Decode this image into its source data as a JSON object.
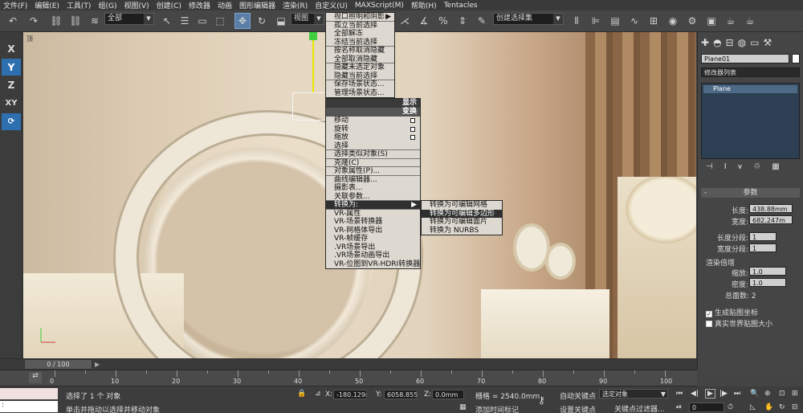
{
  "menubar": [
    "文件(F)",
    "编辑(E)",
    "工具(T)",
    "组(G)",
    "视图(V)",
    "创建(C)",
    "修改器",
    "动画",
    "图形编辑器",
    "渲染(R)",
    "自定义(U)",
    "MAXScript(M)",
    "帮助(H)",
    "Tentacles"
  ],
  "toolbar": {
    "selection_filter": "全部",
    "view_dropdown": "视图",
    "named_selection": "创建选择集"
  },
  "axes": [
    "X",
    "Y",
    "Z",
    "XY"
  ],
  "viewport": {
    "label": "顶"
  },
  "quad_top": [
    {
      "label": "视口照明和阴影",
      "arrow": "▶"
    },
    {
      "label": "孤立当前选择"
    },
    {
      "label": "全部解冻"
    },
    {
      "label": "冻结当前选择"
    },
    {
      "label": "按名称取消隐藏"
    },
    {
      "label": "全部取消隐藏"
    },
    {
      "label": "隐藏未选定对象"
    },
    {
      "label": "隐藏当前选择"
    },
    {
      "label": "保存场景状态..."
    },
    {
      "label": "管理场景状态..."
    }
  ],
  "quad_header_display": "显示",
  "quad_header_transform": "变换",
  "quad_bottom": [
    {
      "label": "移动"
    },
    {
      "label": "旋转"
    },
    {
      "label": "缩放"
    },
    {
      "label": "选择"
    },
    {
      "label": "选择类似对象(S)"
    },
    {
      "label": "克隆(C)"
    },
    {
      "label": "对象属性(P)..."
    },
    {
      "label": "曲线编辑器..."
    },
    {
      "label": "摄影表..."
    },
    {
      "label": "关联参数..."
    },
    {
      "label": "转换为:",
      "arrow": "▶"
    },
    {
      "label": "VR-属性"
    },
    {
      "label": "VR-场景转换器"
    },
    {
      "label": "VR-网格体导出"
    },
    {
      "label": "VR-帧缓存"
    },
    {
      "label": ".VR场景导出"
    },
    {
      "label": ".VR场景动画导出"
    },
    {
      "label": "VR-位图到VR-HDRI转换器"
    }
  ],
  "submenu": [
    "转换为可编辑网格",
    "转换为可编辑多边形",
    "转换为可编辑面片",
    "转换为 NURBS"
  ],
  "rightpanel": {
    "object_name": "Plane01",
    "modifier_list": "修改器列表",
    "stack_item": "Plane",
    "rollout_title": "参数",
    "length_label": "长度:",
    "length_value": "438.88mm",
    "width_label": "宽度:",
    "width_value": "682.247m",
    "length_segs_label": "长度分段:",
    "length_segs": "1",
    "width_segs_label": "宽度分段:",
    "width_segs": "1",
    "render_mult": "渲染倍增",
    "scale_label": "缩放:",
    "scale_value": "1.0",
    "density_label": "密度:",
    "density_value": "1.0",
    "total_faces": "总面数: 2",
    "gen_mapping": "生成贴图坐标",
    "real_world": "真实世界贴图大小"
  },
  "timeline": {
    "frame": "0 / 100",
    "ticks": [
      "0",
      "10",
      "20",
      "30",
      "40",
      "50",
      "60",
      "70",
      "80",
      "90",
      "100"
    ]
  },
  "status": {
    "selected": "选择了 1 个 对象",
    "hint": "单击并拖动以选择并移动对象",
    "x": "-180.129m",
    "y": "6058.855m",
    "z": "0.0mm",
    "grid": "栅格 = 2540.0mm",
    "add_tag": "添加时间标记",
    "autokey": "自动关键点",
    "setkey": "设置关键点",
    "selset": "选定对象",
    "key_filter": "关键点过滤器...",
    "frame_field": "0"
  }
}
